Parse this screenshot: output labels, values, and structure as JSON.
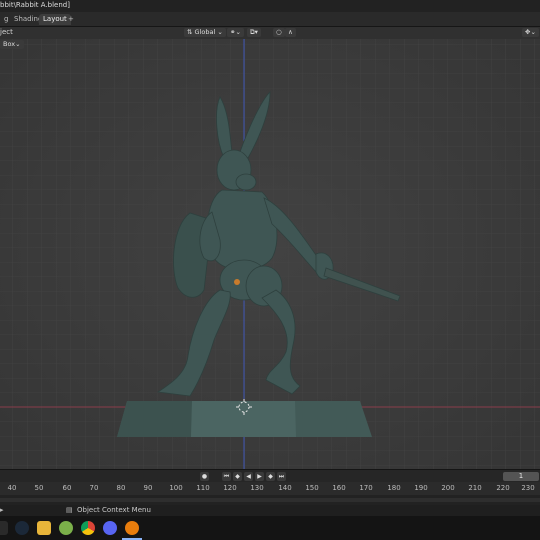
{
  "window": {
    "title_fragment": "bbit\\Rabbit A.blend]"
  },
  "workspace_tabs": [
    "g",
    "Shading",
    "Layout"
  ],
  "workspace_add": "+",
  "header": {
    "mode_fragment": "ject",
    "orientation": "Global",
    "snap_label": "▾",
    "view_fragment": "Box",
    "view_dropdown": "⌄"
  },
  "timeline": {
    "current_frame": "1",
    "ruler_ticks": [
      "40",
      "50",
      "60",
      "70",
      "80",
      "90",
      "100",
      "110",
      "120",
      "130",
      "140",
      "150",
      "160",
      "170",
      "180",
      "190",
      "200",
      "210",
      "220",
      "230"
    ]
  },
  "statusbar": {
    "context_menu_label": "Object Context Menu"
  },
  "colors": {
    "viewport_bg": "#3d3d3d",
    "grid": "#474747",
    "model": "#3f5654",
    "x_axis": "#8a3d4b",
    "z_axis": "#3e55b5"
  },
  "taskbar": {
    "icons": [
      "steam-icon",
      "file-explorer-icon",
      "app-icon",
      "chrome-icon",
      "discord-icon",
      "blender-icon"
    ]
  }
}
